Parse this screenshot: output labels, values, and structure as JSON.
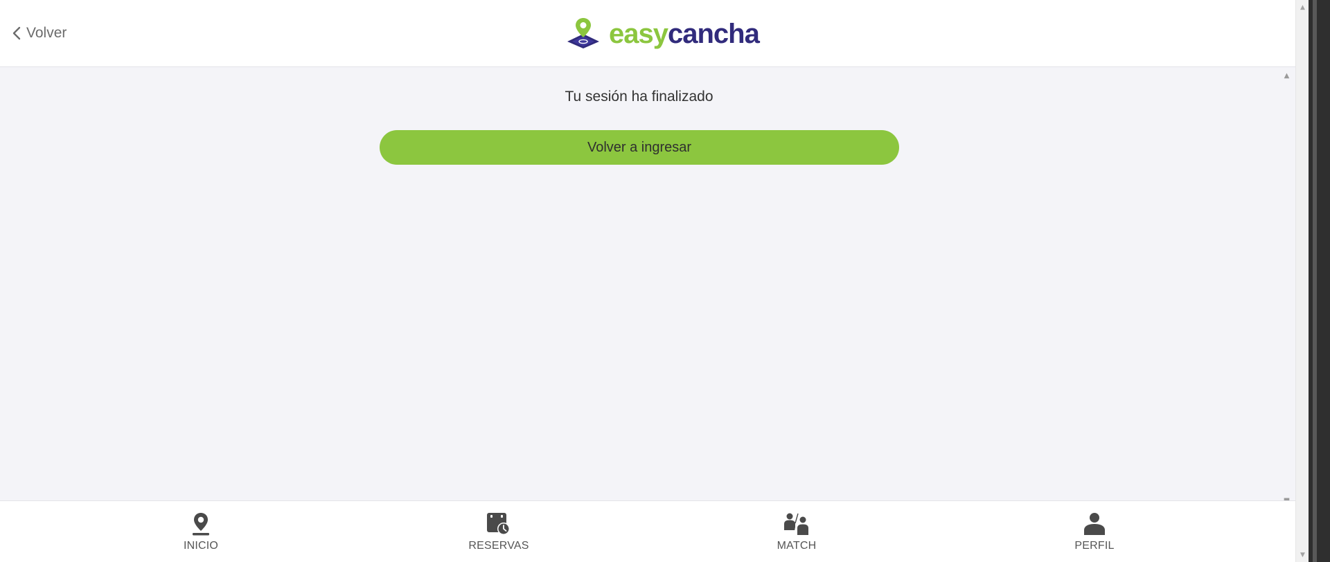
{
  "header": {
    "back_label": "Volver",
    "brand": {
      "part1": "easy",
      "part2": "cancha",
      "color_primary": "#8cc63f",
      "color_secondary": "#312b7c"
    }
  },
  "main": {
    "message": "Tu sesión ha finalizado",
    "relogin_label": "Volver a ingresar",
    "button_color": "#8cc63f"
  },
  "bottom_nav": {
    "items": [
      {
        "label": "INICIO",
        "icon": "location-pin-icon"
      },
      {
        "label": "RESERVAS",
        "icon": "calendar-clock-icon"
      },
      {
        "label": "MATCH",
        "icon": "players-icon"
      },
      {
        "label": "PERFIL",
        "icon": "user-icon"
      }
    ]
  }
}
